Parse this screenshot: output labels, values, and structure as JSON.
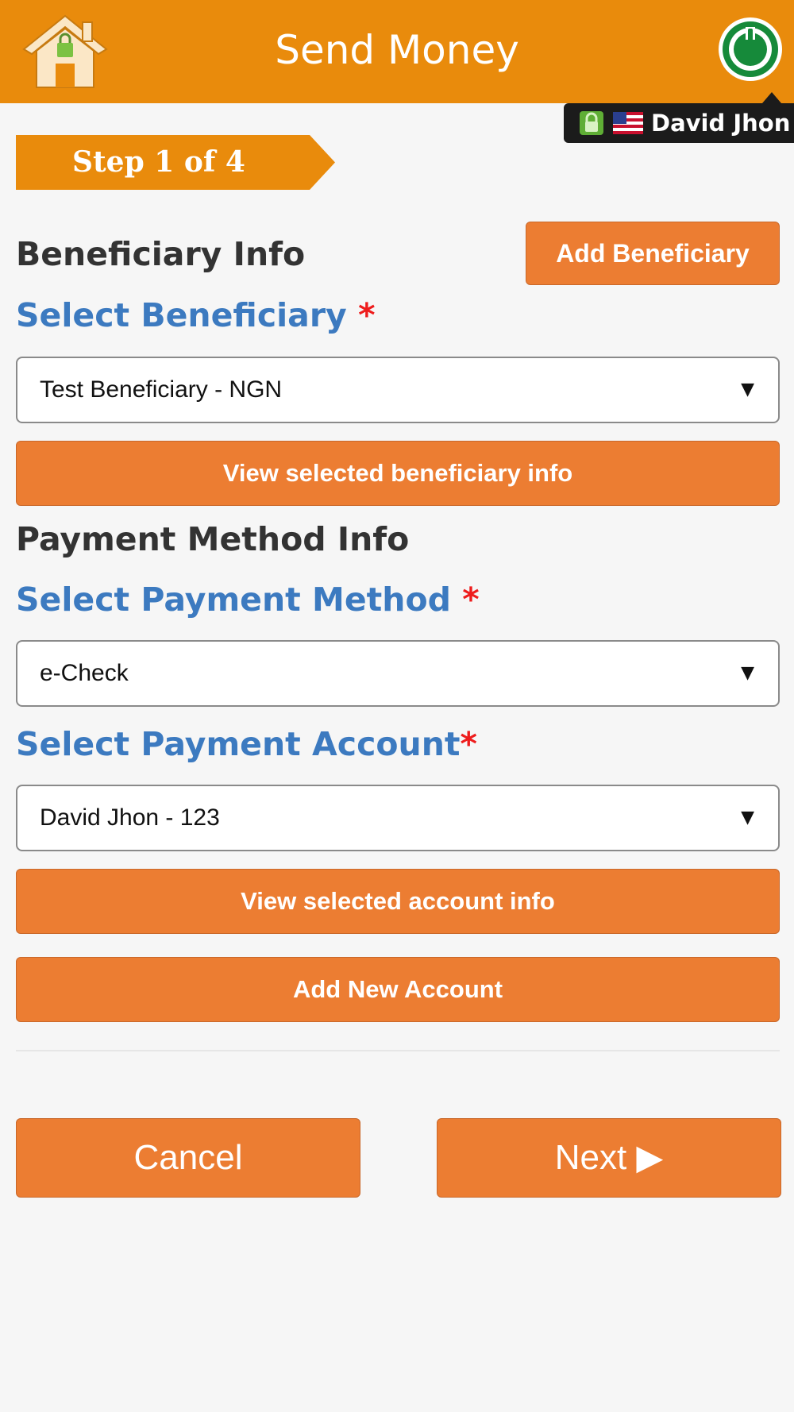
{
  "header": {
    "title": "Send Money",
    "home_icon": "home-lock-icon",
    "power_icon": "power-icon",
    "colors": {
      "header_bg": "#e98b0c",
      "button_bg": "#ec7d32",
      "label_blue": "#3c7ac0",
      "required_red": "#ee1c1c"
    }
  },
  "user_badge": {
    "name": "David Jhon",
    "lock_icon": "lock-icon",
    "flag_icon": "us-flag-icon"
  },
  "step": {
    "label": "Step 1 of 4"
  },
  "beneficiary": {
    "section_title": "Beneficiary Info",
    "add_button": "Add Beneficiary",
    "select_label": "Select Beneficiary",
    "required_mark": "*",
    "selected_value": "Test Beneficiary - NGN",
    "view_button": "View selected beneficiary info"
  },
  "payment": {
    "section_title": "Payment Method Info",
    "method_label": "Select Payment Method",
    "method_required": "*",
    "method_value": "e-Check",
    "account_label": "Select Payment Account",
    "account_required": "*",
    "account_value": "David Jhon - 123",
    "view_account_button": "View selected account info",
    "add_account_button": "Add New Account"
  },
  "actions": {
    "cancel": "Cancel",
    "next": "Next ▶"
  },
  "dropdown_caret": "▼"
}
